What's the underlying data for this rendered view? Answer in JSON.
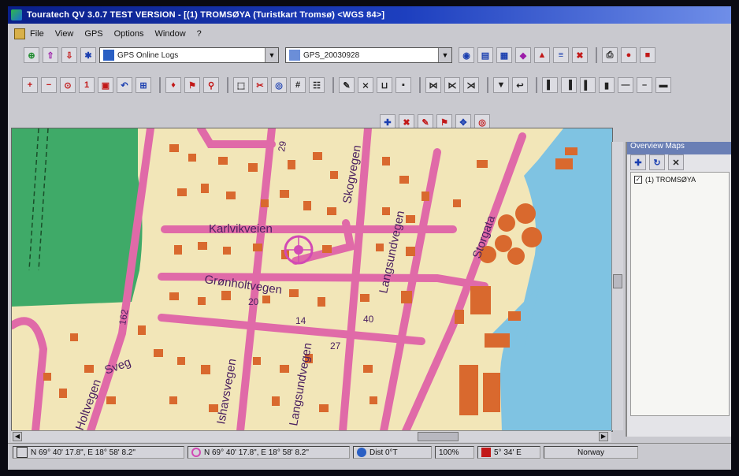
{
  "window": {
    "title": "Touratech QV 3.0.7 TEST VERSION - [(1) TROMSØYA (Turistkart Tromsø) <WGS 84>]"
  },
  "menu": {
    "items": [
      "File",
      "View",
      "GPS",
      "Options",
      "Window",
      "?"
    ]
  },
  "toolbar": {
    "combo1_value": "GPS Online Logs",
    "combo2_value": "GPS_20030928"
  },
  "map": {
    "streets": [
      "Karlvikveien",
      "Grønholtvegen",
      "Skogvegen",
      "Langsundvegen",
      "Storgata",
      "Ishavsvegen",
      "Langsundvegen",
      "Holtvegen",
      "Sveg"
    ],
    "house_numbers": [
      "29",
      "162",
      "27",
      "14",
      "40",
      "20"
    ],
    "colors": {
      "land": "#f2e6b8",
      "park": "#3faa68",
      "water": "#7fc3e2",
      "road": "#e06aa8",
      "building": "#d9692e"
    }
  },
  "panel": {
    "title": "Overview Maps",
    "item_label": "(1) TROMSØYA",
    "item_checked": true
  },
  "status": {
    "pos1": "N 69° 40' 17.8\", E 18° 58' 8.2\"",
    "pos2": "N 69° 40' 17.8\", E 18° 58' 8.2\"",
    "dist": "Dist 0°T",
    "zoom": "100%",
    "heading": "5° 34' E",
    "country": "Norway"
  }
}
